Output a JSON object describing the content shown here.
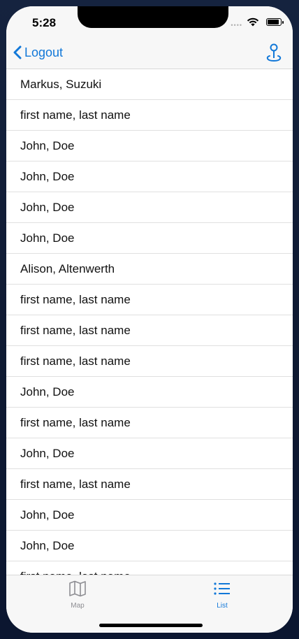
{
  "status_bar": {
    "time": "5:28"
  },
  "nav": {
    "back_label": "Logout",
    "right_icon": "location-pin-icon"
  },
  "list": {
    "rows": [
      "Markus, Suzuki",
      "first name, last name",
      "John, Doe",
      "John, Doe",
      "John, Doe",
      "John, Doe",
      "Alison, Altenwerth",
      "first name, last name",
      "first name, last name",
      "first name, last name",
      "John, Doe",
      "first name, last name",
      "John, Doe",
      "first name, last name",
      "John, Doe",
      "John, Doe",
      "first name, last name"
    ]
  },
  "tabs": [
    {
      "label": "Map",
      "icon": "map-icon",
      "selected": false
    },
    {
      "label": "List",
      "icon": "list-icon",
      "selected": true
    }
  ],
  "colors": {
    "accent": "#1278d8",
    "inactive": "#8e8e93"
  }
}
